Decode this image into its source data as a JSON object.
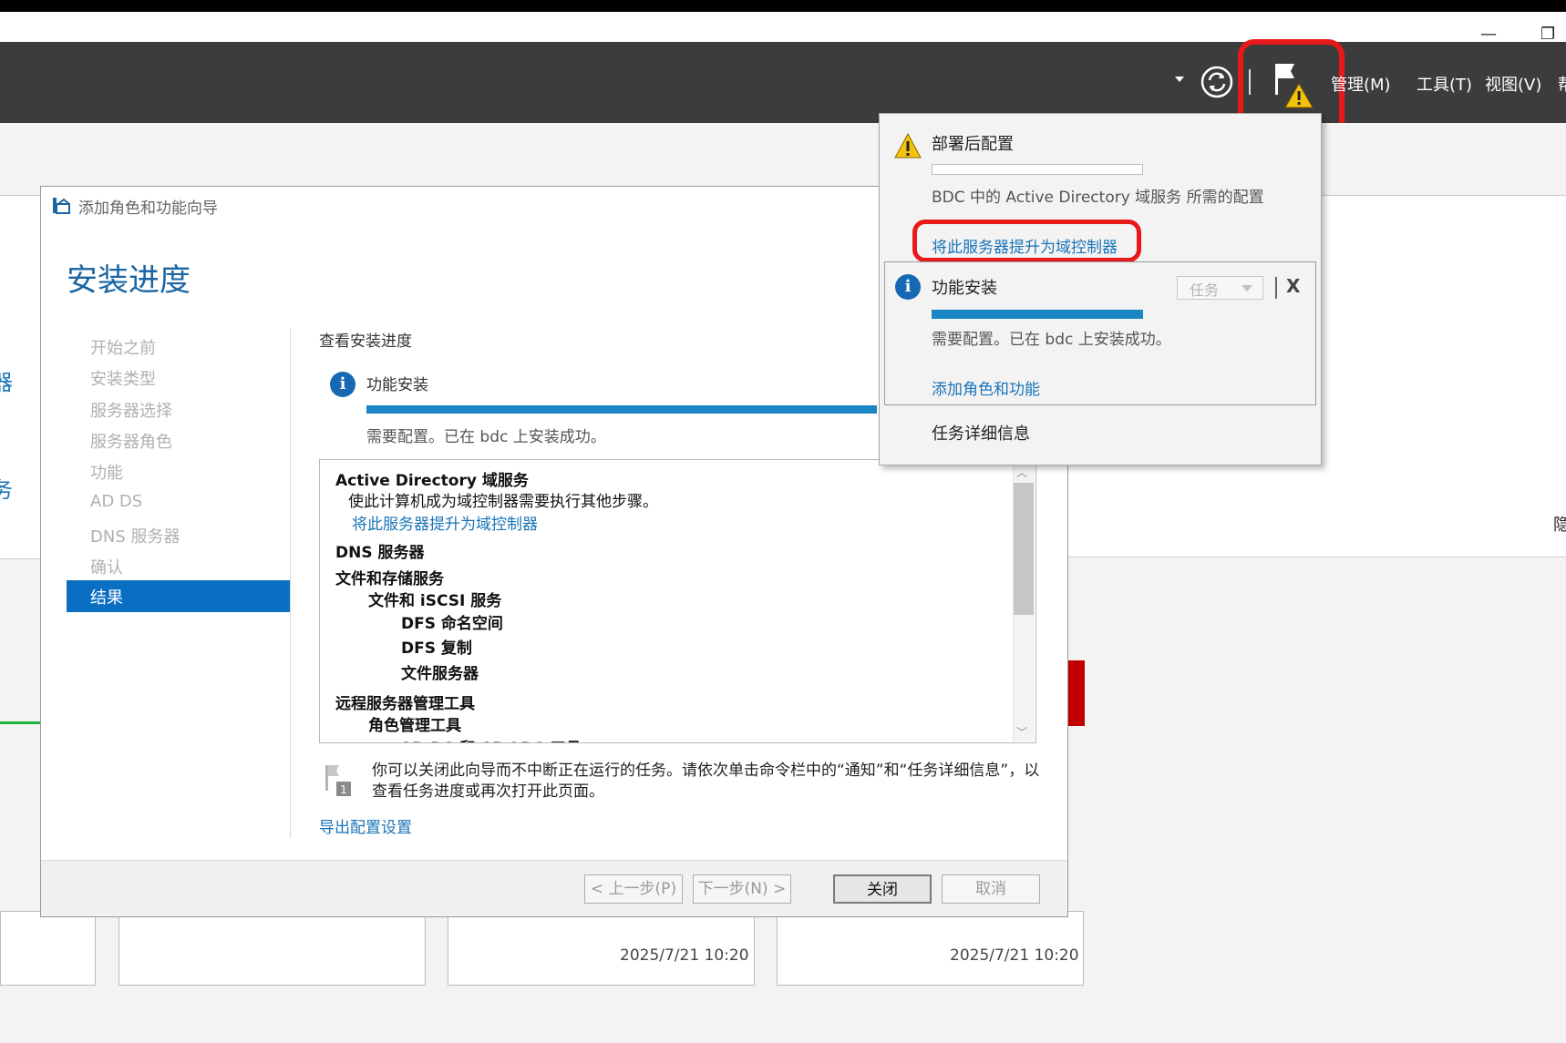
{
  "window": {
    "minimize_glyph": "—",
    "restore_glyph": "❐"
  },
  "command_bar": {
    "menus": [
      "管理(M)",
      "工具(T)",
      "视图(V)",
      "帮"
    ],
    "icons": [
      "dropdown-arrow-icon",
      "refresh-icon",
      "notification-flag-warning-icon"
    ]
  },
  "dashboard": {
    "left_letters": [
      "器",
      "务"
    ],
    "right_edge_char": "隐",
    "tile_times": [
      "2025/7/21 10:20",
      "2025/7/21 10:20"
    ]
  },
  "wizard": {
    "title": "添加角色和功能向导",
    "heading": "安装进度",
    "nav": [
      "开始之前",
      "安装类型",
      "服务器选择",
      "服务器角色",
      "功能",
      "AD DS",
      "DNS 服务器",
      "确认",
      "结果"
    ],
    "current_nav": "结果",
    "section_title": "查看安装进度",
    "task": {
      "name": "功能安装",
      "progress": 1.0,
      "status": "需要配置。已在 bdc 上安装成功。"
    },
    "results": {
      "adds_title": "Active Directory 域服务",
      "adds_desc": "使此计算机成为域控制器需要执行其他步骤。",
      "adds_link": "将此服务器提升为域控制器",
      "dns": "DNS 服务器",
      "file_storage": "文件和存储服务",
      "file_iscsi": "文件和 iSCSI 服务",
      "dfs_ns": "DFS 命名空间",
      "dfs_repl": "DFS 复制",
      "file_server": "文件服务器",
      "rsat": "远程服务器管理工具",
      "role_tools": "角色管理工具",
      "adds_tools_partial": "AD DS 和 AD LDS 工具"
    },
    "note": "你可以关闭此向导而不中断正在运行的任务。请依次单击命令栏中的“通知”和“任务详细信息”，以查看任务进度或再次打开此页面。",
    "export_link": "导出配置设置",
    "buttons": {
      "prev": "< 上一步(P)",
      "next": "下一步(N) >",
      "close": "关闭",
      "cancel": "取消"
    }
  },
  "notifications": {
    "post_deploy": {
      "title": "部署后配置",
      "progress": 0.0,
      "desc": "BDC 中的 Active Directory 域服务 所需的配置",
      "link": "将此服务器提升为域控制器"
    },
    "feature_install": {
      "title": "功能安装",
      "task_dropdown": "任务",
      "close": "X",
      "progress": 1.0,
      "status": "需要配置。已在 bdc 上安装成功。",
      "link": "添加角色和功能"
    },
    "task_details": "任务详细信息"
  },
  "colors": {
    "accent": "#1a74b7",
    "highlight": "#e8191b",
    "progress": "#1b86c4",
    "nav_selected": "#0a6fc2"
  }
}
